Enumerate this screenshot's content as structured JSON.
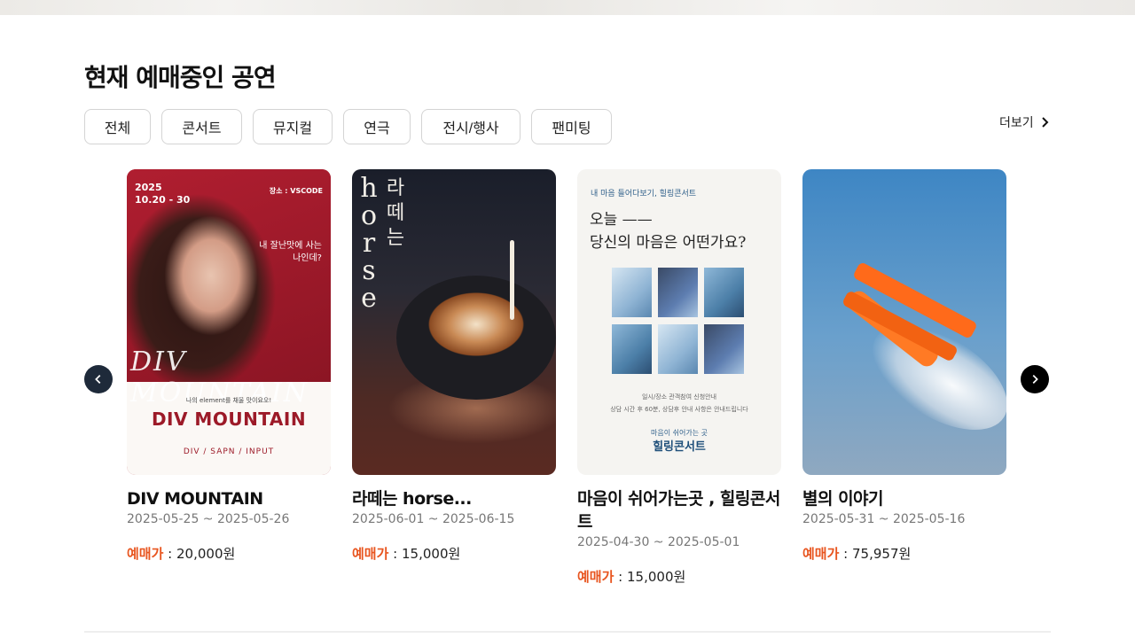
{
  "section": {
    "title": "현재 예매중인 공연",
    "more_label": "더보기"
  },
  "filters": [
    "전체",
    "콘서트",
    "뮤지컬",
    "연극",
    "전시/행사",
    "팬미팅"
  ],
  "price_label": "예매가",
  "price_sep": " : ",
  "cards": [
    {
      "title": "DIV MOUNTAIN",
      "date": "2025-05-25 ~ 2025-05-26",
      "price": "20,000원",
      "poster": {
        "year": "2025",
        "dates": "10.20 - 30",
        "venue": "장소 : VSCODE",
        "quote": "내 잘난맛에 사는\n나인데?",
        "script": "DIV MOUNTAIN",
        "small": "나의 element를 채울 맛이요오!",
        "big": "DIV MOUNTAIN",
        "tags": "DIV / SAPN / INPUT"
      }
    },
    {
      "title": "라떼는 horse...",
      "date": "2025-06-01 ~ 2025-06-15",
      "price": "15,000원",
      "poster": {
        "word": "horse",
        "hangul": "라떼는"
      }
    },
    {
      "title": "마음이 쉬어가는곳 , 힐링콘서트",
      "date": "2025-04-30 ~ 2025-05-01",
      "price": "15,000원",
      "poster": {
        "sub": "내 마음 들어다보기, 힐링콘서트",
        "line1": "오늘 ——",
        "line2": "당신의 마음은 어떤가요?",
        "info1": "일시/장소   관객참여   신청안내",
        "info2": "상담 시간 후 60분, 상담후 안내 사항은 안내드립니다",
        "foot1": "마음이 쉬어가는 곳",
        "foot2": "힐링콘서트"
      }
    },
    {
      "title": "별의 이야기",
      "date": "2025-05-31 ~ 2025-05-16",
      "price": "75,957원",
      "poster": {}
    }
  ],
  "colors": {
    "accent": "#e8551f",
    "nav_prev": "#1e2a3a",
    "nav_next": "#000000"
  }
}
